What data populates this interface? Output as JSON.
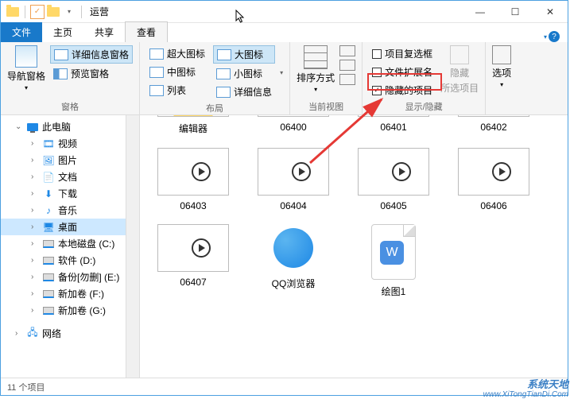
{
  "window": {
    "title": "运营",
    "controls": {
      "min": "—",
      "max": "☐",
      "close": "✕"
    }
  },
  "tabs": {
    "file": "文件",
    "home": "主页",
    "share": "共享",
    "view": "查看"
  },
  "ribbon": {
    "panes": {
      "nav": "导航窗格",
      "detail": "详细信息窗格",
      "preview": "预览窗格",
      "label": "窗格"
    },
    "layout": {
      "xlarge": "超大图标",
      "large": "大图标",
      "medium": "中图标",
      "small": "小图标",
      "list": "列表",
      "details": "详细信息",
      "label": "布局"
    },
    "view": {
      "sort": "排序方式",
      "label": "当前视图"
    },
    "showhide": {
      "checkboxes": "项目复选框",
      "extensions": "文件扩展名",
      "hidden": "隐藏的项目",
      "hide": "隐藏",
      "selected": "所选项目",
      "label": "显示/隐藏"
    },
    "options": "选项"
  },
  "sidebar": {
    "thispc": "此电脑",
    "videos": "视频",
    "pictures": "图片",
    "documents": "文档",
    "downloads": "下载",
    "music": "音乐",
    "desktop": "桌面",
    "drive_c": "本地磁盘 (C:)",
    "drive_d": "软件 (D:)",
    "drive_e": "备份[勿删] (E:)",
    "drive_f": "新加卷 (F:)",
    "drive_g": "新加卷 (G:)",
    "network": "网络"
  },
  "files": {
    "f0": "编辑器",
    "f1": "06400",
    "f2": "06401",
    "f3": "06402",
    "f4": "06403",
    "f5": "06404",
    "f6": "06405",
    "f7": "06406",
    "f8": "06407",
    "f9": "QQ浏览器",
    "f10": "绘图1"
  },
  "statusbar": {
    "count": "11 个项目"
  },
  "watermark": {
    "cn": "系统天地",
    "url": "www.XiTongTianDi.Com"
  }
}
